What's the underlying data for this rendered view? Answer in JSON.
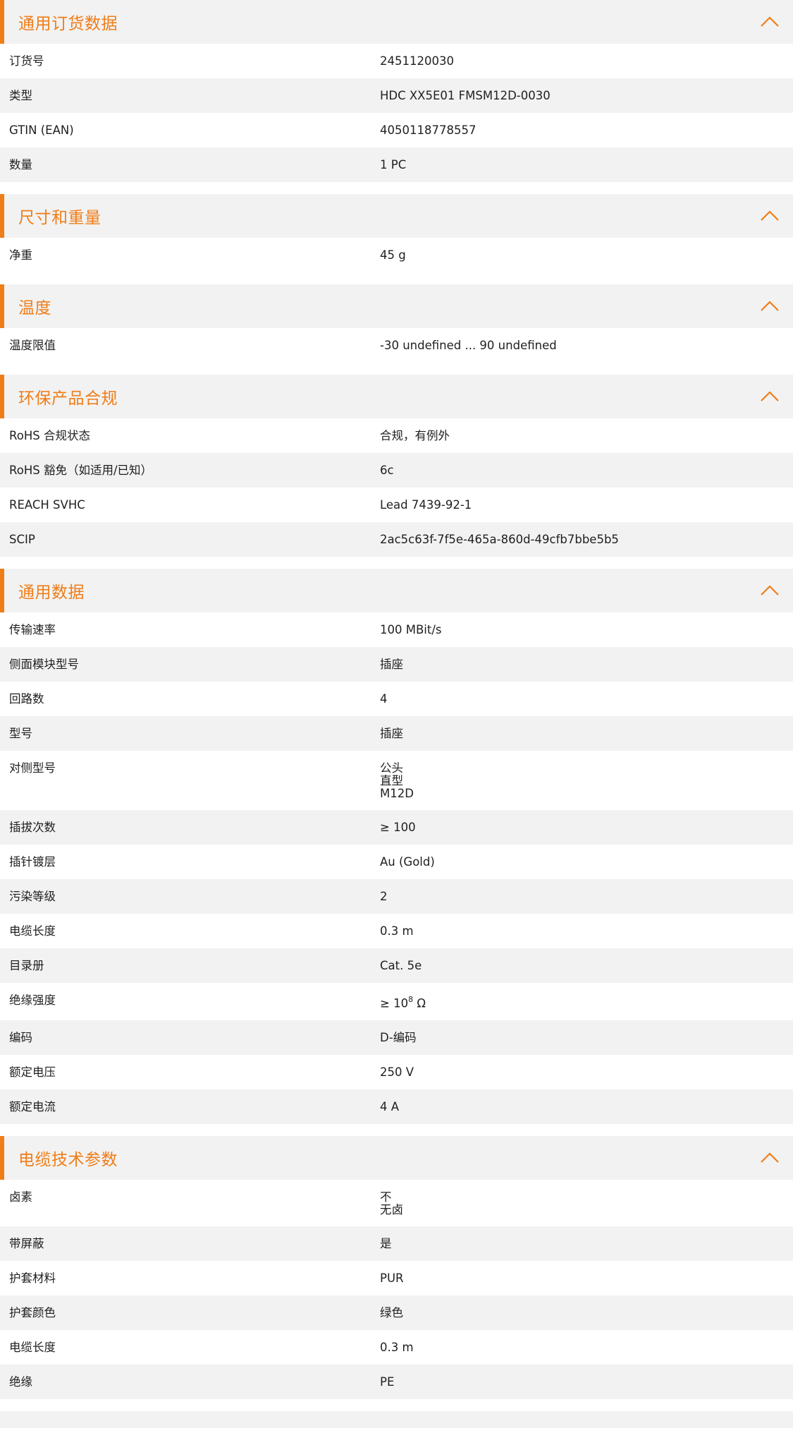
{
  "accent_color": "#ef7d18",
  "row_alt_color": "#f2f2f2",
  "icons": {
    "collapse": "chevron-up-icon"
  },
  "sections": [
    {
      "title": "通用订货数据",
      "rows": [
        {
          "label": "订货号",
          "value": "2451120030"
        },
        {
          "label": "类型",
          "value": "HDC XX5E01 FMSM12D-0030"
        },
        {
          "label": "GTIN (EAN)",
          "value": "4050118778557"
        },
        {
          "label": "数量",
          "value": "1  PC"
        }
      ]
    },
    {
      "title": "尺寸和重量",
      "rows": [
        {
          "label": "净重",
          "value": "45  g"
        }
      ]
    },
    {
      "title": "温度",
      "rows": [
        {
          "label": "温度限值",
          "value": "-30 undefined ... 90 undefined"
        }
      ]
    },
    {
      "title": "环保产品合规",
      "rows": [
        {
          "label": "RoHS 合规状态",
          "value": "合规，有例外"
        },
        {
          "label": "RoHS 豁免（如适用/已知）",
          "value": "6c"
        },
        {
          "label": "REACH SVHC",
          "value": "Lead 7439-92-1"
        },
        {
          "label": "SCIP",
          "value": "2ac5c63f-7f5e-465a-860d-49cfb7bbe5b5"
        }
      ]
    },
    {
      "title": "通用数据",
      "rows": [
        {
          "label": "传输速率",
          "value": "100 MBit/s"
        },
        {
          "label": "侧面模块型号",
          "value": "插座"
        },
        {
          "label": "回路数",
          "value": "4"
        },
        {
          "label": "型号",
          "value": "插座"
        },
        {
          "label": "对侧型号",
          "value": "公头\n直型\nM12D"
        },
        {
          "label": "插拔次数",
          "value": "≥ 100"
        },
        {
          "label": "插针镀层",
          "value": "Au (Gold)"
        },
        {
          "label": "污染等级",
          "value": "2"
        },
        {
          "label": "电缆长度",
          "value": "0.3  m"
        },
        {
          "label": "目录册",
          "value": "Cat. 5e"
        },
        {
          "label": "绝缘强度",
          "value": "≥ 10",
          "value_sup": "8",
          "value_suffix": " Ω"
        },
        {
          "label": "编码",
          "value": "D-编码"
        },
        {
          "label": "额定电压",
          "value": "250  V"
        },
        {
          "label": "额定电流",
          "value": "4  A"
        }
      ]
    },
    {
      "title": "电缆技术参数",
      "rows": [
        {
          "label": "卤素",
          "value": "不\n无卤"
        },
        {
          "label": "带屏蔽",
          "value": "是"
        },
        {
          "label": "护套材料",
          "value": "PUR"
        },
        {
          "label": "护套颜色",
          "value": "绿色"
        },
        {
          "label": "电缆长度",
          "value": "0.3  m"
        },
        {
          "label": "绝缘",
          "value": "PE"
        }
      ]
    }
  ]
}
